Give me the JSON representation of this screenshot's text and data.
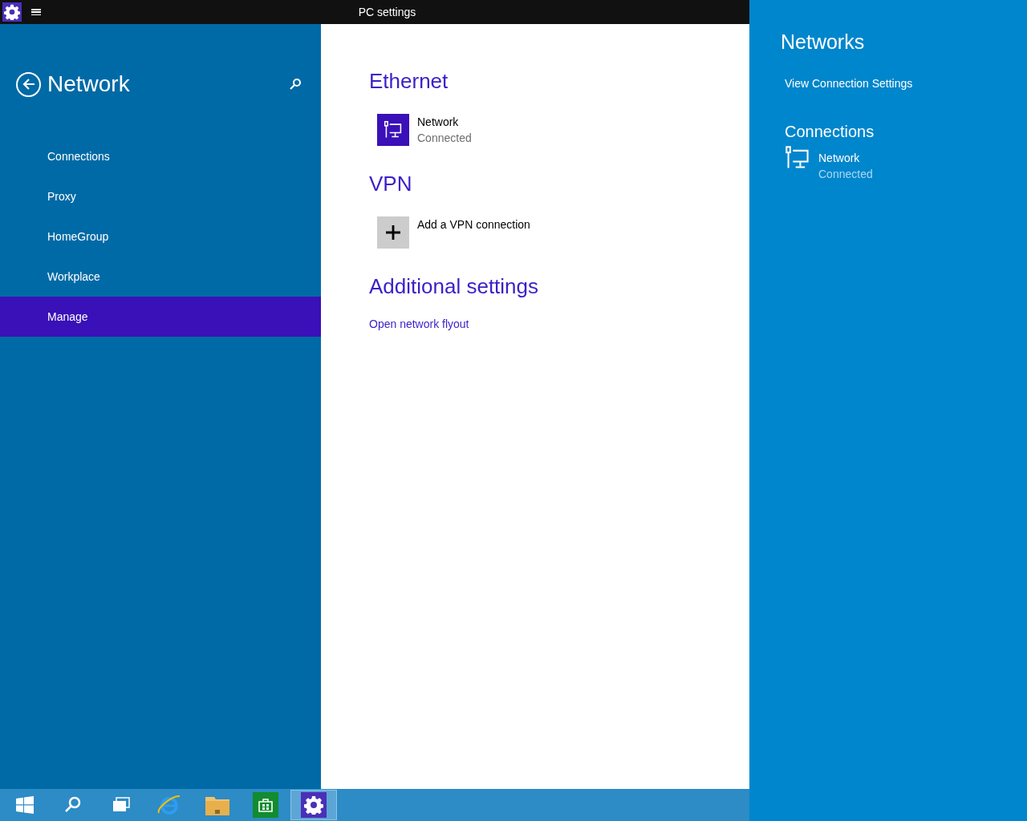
{
  "window": {
    "title": "PC settings"
  },
  "sidebar": {
    "title": "Network",
    "items": [
      {
        "label": "Connections",
        "selected": false
      },
      {
        "label": "Proxy",
        "selected": false
      },
      {
        "label": "HomeGroup",
        "selected": false
      },
      {
        "label": "Workplace",
        "selected": false
      },
      {
        "label": "Manage",
        "selected": true
      }
    ]
  },
  "content": {
    "sections": [
      {
        "heading": "Ethernet",
        "kind": "connection",
        "name": "Network",
        "status": "Connected"
      },
      {
        "heading": "VPN",
        "kind": "add",
        "name": "Add a VPN connection"
      },
      {
        "heading": "Additional settings",
        "kind": "link",
        "name": "Open network flyout"
      }
    ]
  },
  "flyout": {
    "title": "Networks",
    "link": "View Connection Settings",
    "connections_heading": "Connections",
    "connections": [
      {
        "name": "Network",
        "status": "Connected"
      }
    ]
  },
  "taskbar": [
    {
      "kind": "start",
      "selected": false
    },
    {
      "kind": "search",
      "selected": false
    },
    {
      "kind": "taskview",
      "selected": false
    },
    {
      "kind": "browser",
      "selected": false
    },
    {
      "kind": "folder",
      "selected": false
    },
    {
      "kind": "store",
      "selected": false
    },
    {
      "kind": "settings",
      "selected": true
    }
  ]
}
